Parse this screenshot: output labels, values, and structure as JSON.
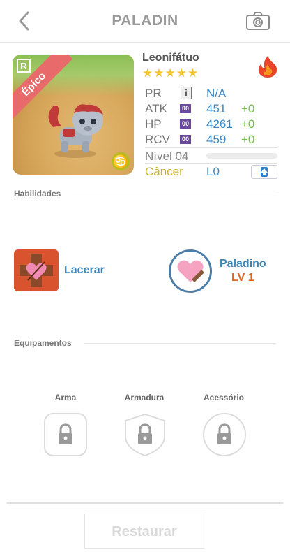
{
  "header": {
    "title": "PALADIN",
    "back_icon": "chevron-left-icon",
    "camera_icon": "camera-icon"
  },
  "monster": {
    "name": "Leonifátuo",
    "rarity_label": "Épico",
    "rarity_badge": "R",
    "stars": 5,
    "stars_text": "★★★★★",
    "element_icon": "fire-icon",
    "zodiac_glyph": "♋",
    "ribbon_color": "#e86a6a"
  },
  "stats": [
    {
      "label": "PR",
      "value": "N/A",
      "bonus": "",
      "icon": "info-icon",
      "icon_text": "i"
    },
    {
      "label": "ATK",
      "value": "451",
      "bonus": "+0",
      "icon": "stat-badge-icon",
      "icon_text": "00"
    },
    {
      "label": "HP",
      "value": "4261",
      "bonus": "+0",
      "icon": "stat-badge-icon",
      "icon_text": "00"
    },
    {
      "label": "RCV",
      "value": "459",
      "bonus": "+0",
      "icon": "stat-badge-icon",
      "icon_text": "00"
    }
  ],
  "level": {
    "label": "Nível 04",
    "progress": 0.0
  },
  "sign": {
    "label": "Câncer",
    "rank": "L0"
  },
  "sections": {
    "skills": "Habilidades",
    "equipment": "Equipamentos"
  },
  "skills": {
    "active": {
      "name": "Lacerar"
    },
    "leader": {
      "name": "Paladino",
      "level": "LV 1"
    }
  },
  "equipment": [
    {
      "label": "Arma",
      "locked": true
    },
    {
      "label": "Armadura",
      "locked": true
    },
    {
      "label": "Acessório",
      "locked": true
    }
  ],
  "footer": {
    "restore_label": "Restaurar"
  },
  "colors": {
    "accent_blue": "#3b88c4",
    "bonus_green": "#76c04a",
    "sign_yellow": "#c8b529",
    "level_orange": "#e0651f"
  }
}
